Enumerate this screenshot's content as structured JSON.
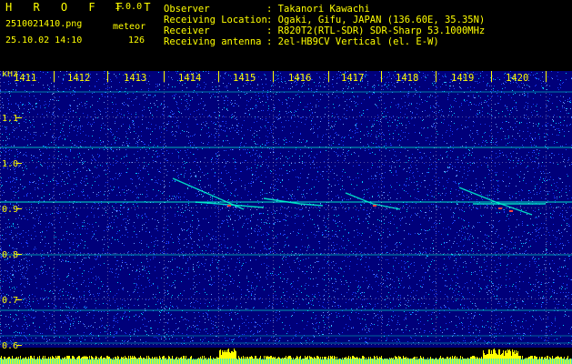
{
  "app": {
    "logo": "H R O F F T",
    "version": "1.0.0"
  },
  "file": {
    "name": "2510021410.png",
    "datetime": "25.10.02 14:10"
  },
  "meteor": {
    "label": "meteor",
    "count": "126"
  },
  "info": [
    {
      "key": "Observer",
      "sep": ":",
      "value": "Takanori Kawachi"
    },
    {
      "key": "Receiving Location",
      "sep": ":",
      "value": "Ogaki, Gifu, JAPAN (136.60E, 35.35N)"
    },
    {
      "key": "Receiver",
      "sep": ":",
      "value": "R820T2(RTL-SDR) SDR-Sharp 53.1000MHz"
    },
    {
      "key": "Receiving antenna",
      "sep": ":",
      "value": "2el-HB9CV Vertical (el. E-W)"
    }
  ],
  "spectrogram": {
    "y_unit": "kHz",
    "y_ticks": [
      "1.1",
      "1.0",
      "0.9",
      "0.8",
      "0.7",
      "0.6"
    ],
    "x_ticks": [
      "1411",
      "1412",
      "1413",
      "1414",
      "1415",
      "1416",
      "1417",
      "1418",
      "1419",
      "1420"
    ],
    "colors": {
      "background": "#00007a",
      "noise_mid": "#1a3cff",
      "noise_hi": "#00c8ff",
      "line": "#00ffd0",
      "tick": "#ffff00",
      "grid": "#ffffff",
      "meteor_core": "#ff4040"
    }
  }
}
